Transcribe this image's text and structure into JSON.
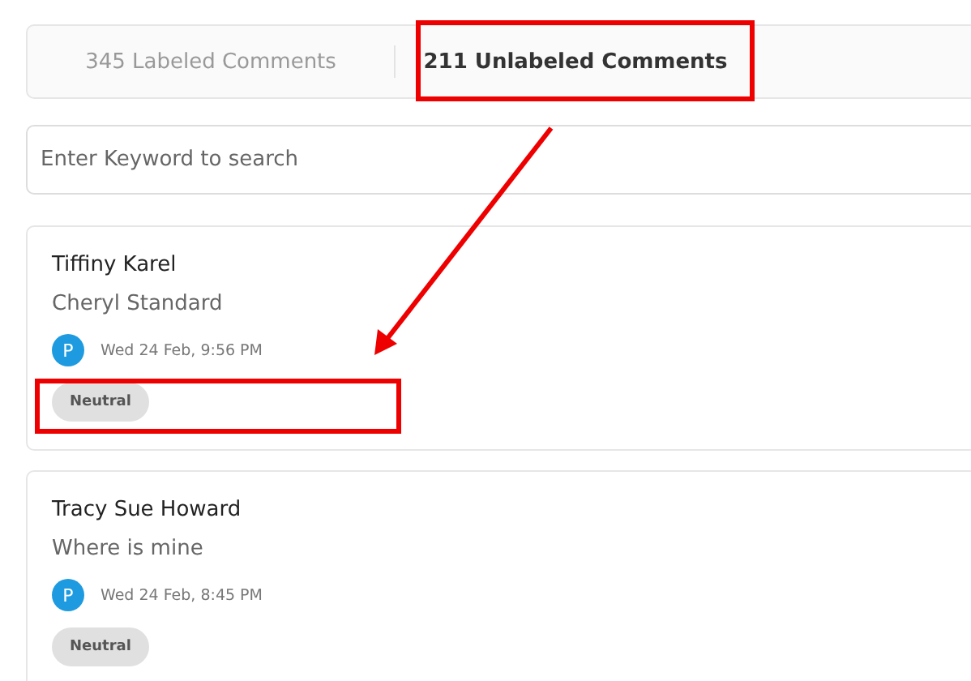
{
  "tabs": [
    {
      "label": "345 Labeled Comments",
      "selected": false
    },
    {
      "label": "211 Unlabeled Comments",
      "selected": true
    }
  ],
  "search": {
    "placeholder": "Enter Keyword to search"
  },
  "comments": [
    {
      "author": "Tiffiny Karel",
      "text": "Cheryl Standard",
      "avatar": "P",
      "time": "Wed 24 Feb, 9:56 PM",
      "tag": "Neutral"
    },
    {
      "author": "Tracy Sue Howard",
      "text": "Where is mine",
      "avatar": "P",
      "time": "Wed 24 Feb, 8:45 PM",
      "tag": "Neutral"
    }
  ],
  "annotations": [
    {
      "kind": "box"
    },
    {
      "kind": "arrow"
    },
    {
      "kind": "box"
    }
  ]
}
